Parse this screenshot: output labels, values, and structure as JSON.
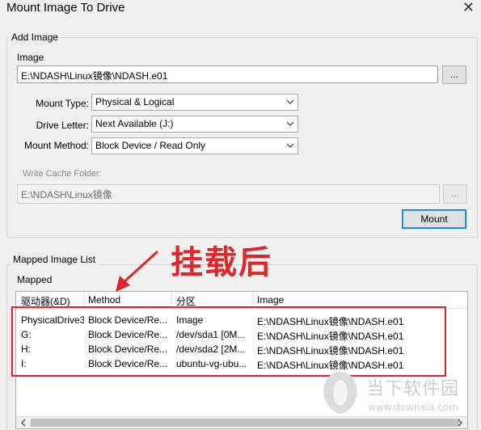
{
  "window": {
    "title": "Mount Image To Drive"
  },
  "add_image": {
    "group_label": "Add Image",
    "image_label": "Image",
    "image_value": "E:\\NDASH\\Linux镜像\\NDASH.e01",
    "browse_label": "...",
    "mount_type_label": "Mount Type:",
    "mount_type_value": "Physical & Logical",
    "drive_letter_label": "Drive Letter:",
    "drive_letter_value": "Next Available (J:)",
    "mount_method_label": "Mount Method:",
    "mount_method_value": "Block Device / Read Only",
    "write_cache_label": "Write Cache Folder:",
    "write_cache_value": "E:\\NDASH\\Linux镜像",
    "write_cache_browse": "...",
    "mount_button": "Mount"
  },
  "mapped": {
    "group_label": "Mapped Image List",
    "sub_label": "Mapped",
    "columns": [
      "驱动器(&D)",
      "Method",
      "分区",
      "Image"
    ],
    "rows": [
      [
        "PhysicalDrive3",
        "Block Device/Re...",
        "Image",
        "E:\\NDASH\\Linux镜像\\NDASH.e01"
      ],
      [
        "G:",
        "Block Device/Re...",
        "/dev/sda1 [0M...",
        "E:\\NDASH\\Linux镜像\\NDASH.e01"
      ],
      [
        "H:",
        "Block Device/Re...",
        "/dev/sda2 [2M...",
        "E:\\NDASH\\Linux镜像\\NDASH.e01"
      ],
      [
        "I:",
        "Block Device/Re...",
        "ubuntu-vg-ubu...",
        "E:\\NDASH\\Linux镜像\\NDASH.e01"
      ]
    ]
  },
  "annotation": {
    "text": "挂载后",
    "color": "#e0262a"
  },
  "watermark": {
    "name": "当下软件园",
    "url": "www.downxia.com"
  }
}
